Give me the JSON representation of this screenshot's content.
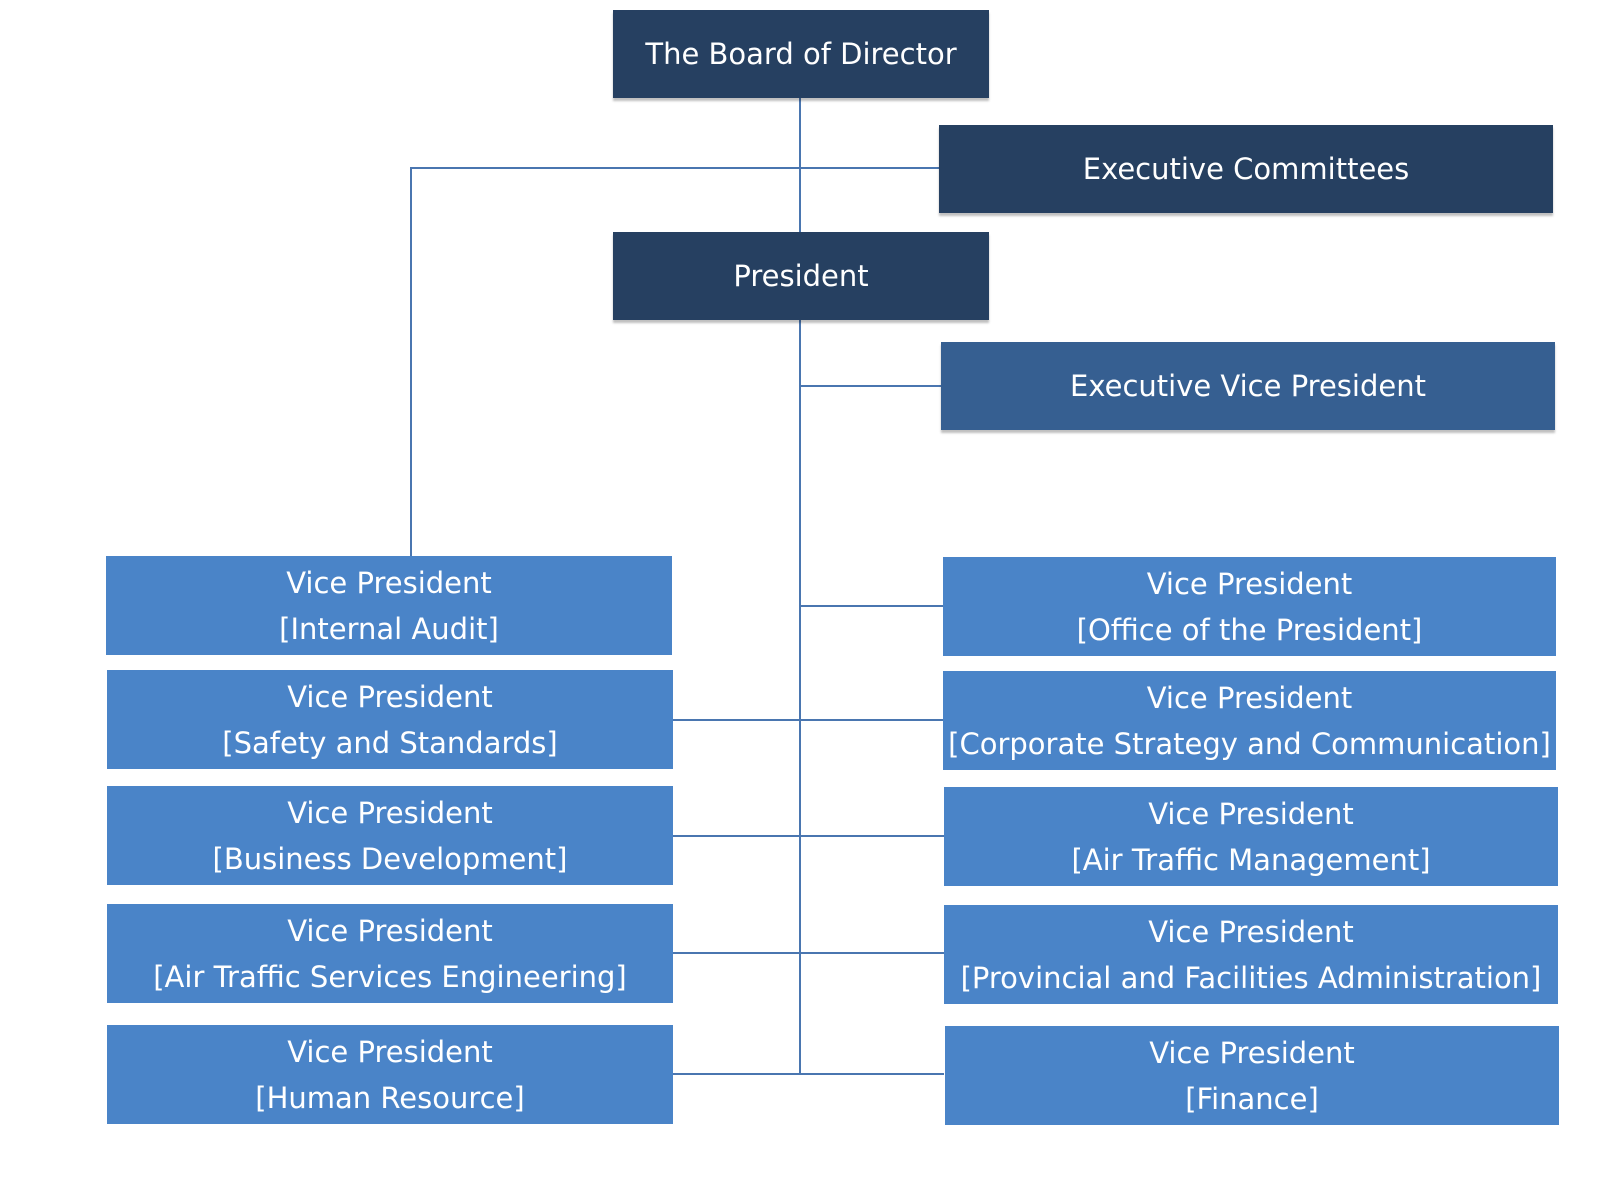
{
  "colors": {
    "top": "#264061",
    "executive_vice_president": "#365f91",
    "vice_president": "#4a84c8",
    "connector": "#4a76b0"
  },
  "board": "The Board of Director",
  "executive_committees": "Executive Committees",
  "president": "President",
  "executive_vice_president": "Executive Vice President",
  "left_vps": [
    {
      "title": "Vice President",
      "dept": "[Internal Audit]"
    },
    {
      "title": "Vice President",
      "dept": "[Safety and Standards]"
    },
    {
      "title": "Vice President",
      "dept": "[Business Development]"
    },
    {
      "title": "Vice President",
      "dept": "[Air Traffic Services Engineering]"
    },
    {
      "title": "Vice President",
      "dept": "[Human Resource]"
    }
  ],
  "right_vps": [
    {
      "title": "Vice President",
      "dept": "[Office of the President]"
    },
    {
      "title": "Vice President",
      "dept": "[Corporate Strategy and Communication]"
    },
    {
      "title": "Vice President",
      "dept": "[Air Traffic Management]"
    },
    {
      "title": "Vice President",
      "dept": "[Provincial and Facilities Administration]"
    },
    {
      "title": "Vice President",
      "dept": "[Finance]"
    }
  ]
}
